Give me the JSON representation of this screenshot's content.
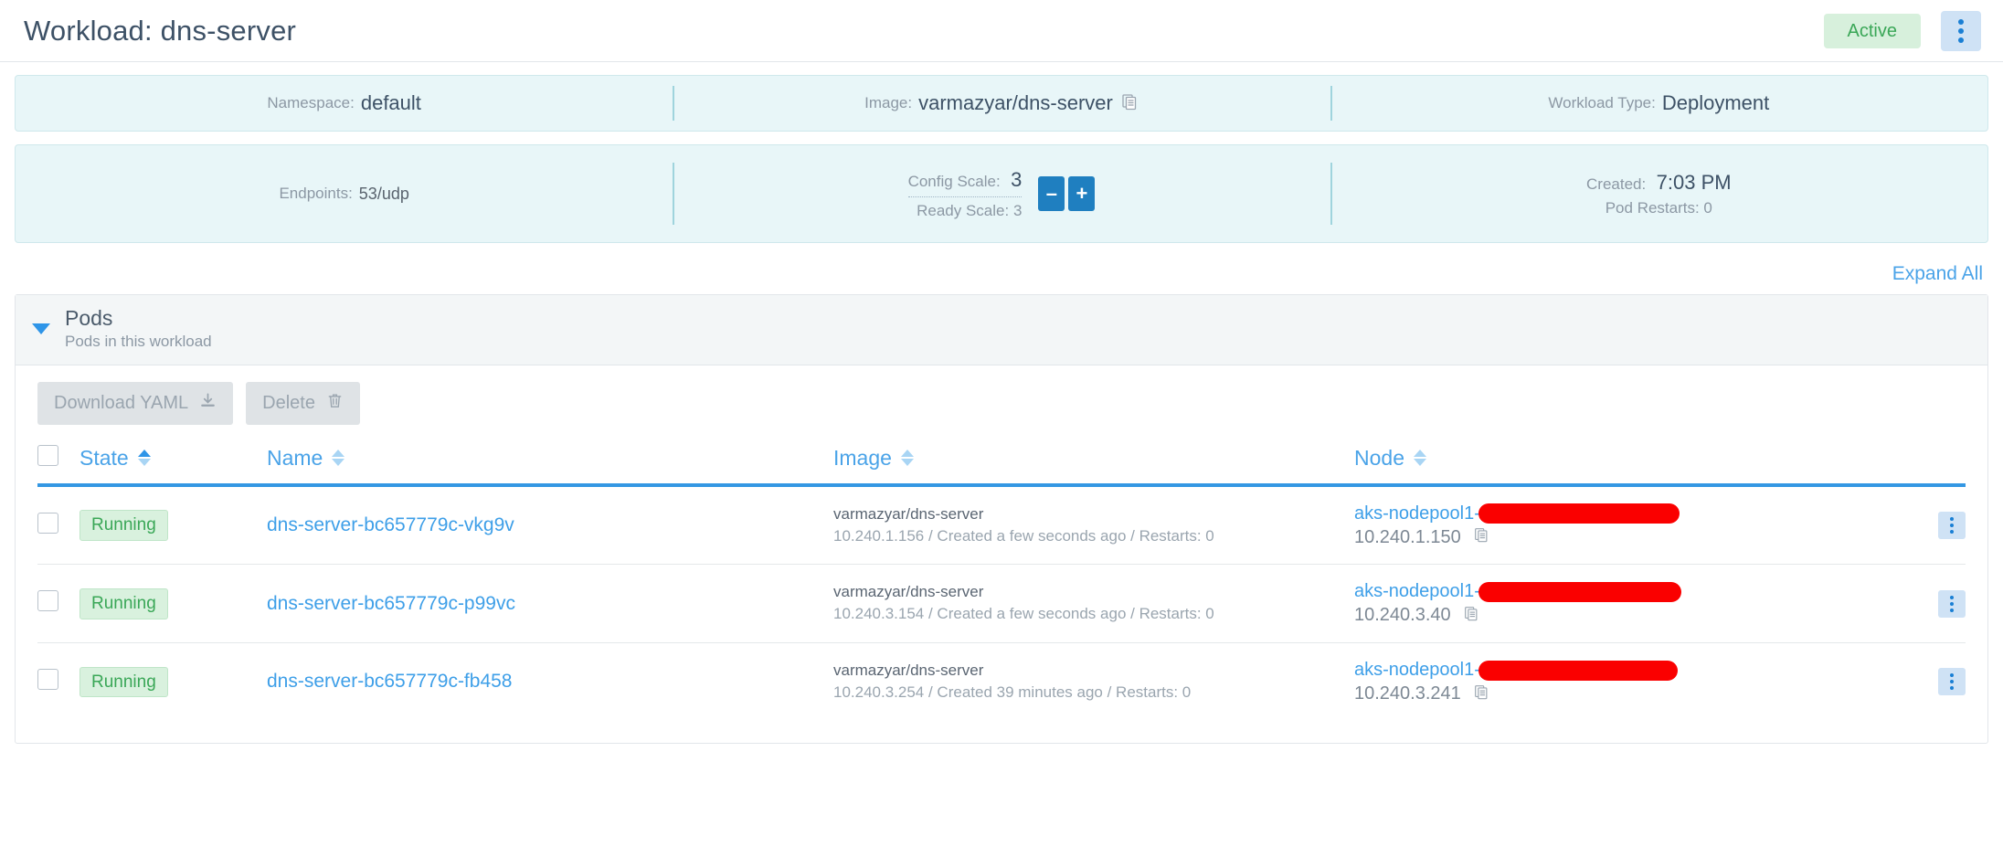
{
  "header": {
    "title": "Workload: dns-server",
    "state_badge": "Active",
    "kebab_icon": "vertical-dots-icon"
  },
  "info_bar_1": [
    {
      "label": "Namespace:",
      "value": "default",
      "icon": null
    },
    {
      "label": "Image:",
      "value": "varmazyar/dns-server",
      "icon": "copy-icon"
    },
    {
      "label": "Workload Type:",
      "value": "Deployment",
      "icon": null
    }
  ],
  "info_bar_2": {
    "endpoints": {
      "label": "Endpoints:",
      "value": "53/udp"
    },
    "scale": {
      "config_label": "Config Scale:",
      "config_value": "3",
      "ready_label": "Ready Scale: 3",
      "decrement": "–",
      "increment": "+"
    },
    "created": {
      "label": "Created:",
      "value": "7:03 PM",
      "restarts": "Pod Restarts: 0"
    }
  },
  "expand_all": "Expand All",
  "pods_panel": {
    "title": "Pods",
    "subtitle": "Pods in this workload",
    "caret_icon": "caret-down-icon",
    "toolbar": [
      {
        "label": "Download YAML",
        "icon": "download-icon"
      },
      {
        "label": "Delete",
        "icon": "trash-icon"
      }
    ],
    "columns": [
      {
        "label": "State",
        "sorted": true
      },
      {
        "label": "Name",
        "sorted": false
      },
      {
        "label": "Image",
        "sorted": false
      },
      {
        "label": "Node",
        "sorted": false
      }
    ],
    "rows": [
      {
        "state": "Running",
        "name": "dns-server-bc657779c-vkg9v",
        "image_name": "varmazyar/dns-server",
        "image_meta": "10.240.1.156 / Created a few seconds ago / Restarts: 0",
        "node_name": "aks-nodepool1-",
        "node_redacted": true,
        "node_ip": "10.240.1.150",
        "node_copy_icon": "copy-icon",
        "kebab_icon": "vertical-dots-icon"
      },
      {
        "state": "Running",
        "name": "dns-server-bc657779c-p99vc",
        "image_name": "varmazyar/dns-server",
        "image_meta": "10.240.3.154 / Created a few seconds ago / Restarts: 0",
        "node_name": "aks-nodepool1-",
        "node_redacted": true,
        "node_ip": "10.240.3.40",
        "node_copy_icon": "copy-icon",
        "kebab_icon": "vertical-dots-icon"
      },
      {
        "state": "Running",
        "name": "dns-server-bc657779c-fb458",
        "image_name": "varmazyar/dns-server",
        "image_meta": "10.240.3.254 / Created 39 minutes ago / Restarts: 0",
        "node_name": "aks-nodepool1-",
        "node_redacted": true,
        "node_ip": "10.240.3.241",
        "node_copy_icon": "copy-icon",
        "kebab_icon": "vertical-dots-icon"
      }
    ]
  },
  "colors": {
    "accent_blue": "#3497e3",
    "link_blue": "#4aa3e8",
    "badge_green_bg": "#d7f0dc",
    "badge_green_fg": "#3aa757",
    "info_bar_bg": "#e8f6f8",
    "redaction_red": "#fa0000"
  }
}
